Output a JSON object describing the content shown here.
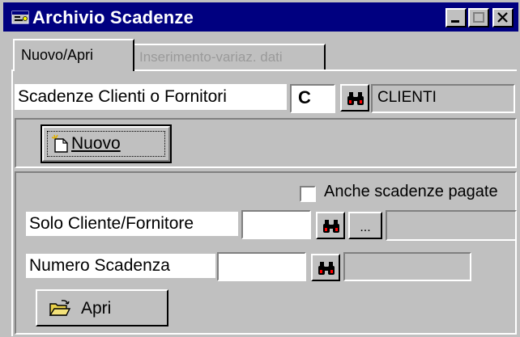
{
  "window": {
    "title": "Archivio Scadenze",
    "icon": "app-window-icon"
  },
  "tabs": [
    {
      "label": "Nuovo/Apri",
      "active": true
    },
    {
      "label": "Inserimento-variaz. dati",
      "active": false
    }
  ],
  "section_top": {
    "label": "Scadenze Clienti o Fornitori",
    "code_value": "C",
    "description_value": "CLIENTI"
  },
  "section_new": {
    "new_button_label": "Nuovo",
    "icon": "new-document-icon"
  },
  "section_open": {
    "checkbox_label": "Anche scadenze pagate",
    "checkbox_checked": false,
    "customer_label": "Solo Cliente/Fornitore",
    "customer_value": "",
    "ellipsis_label": "...",
    "customer_description": "",
    "number_label": "Numero Scadenza",
    "number_value": "",
    "number_description": "",
    "open_button_label": "Apri",
    "icon": "open-folder-icon"
  },
  "colors": {
    "titlebar": "#000080",
    "face": "#c0c0c0",
    "disabled_text": "#9a9a9a"
  }
}
